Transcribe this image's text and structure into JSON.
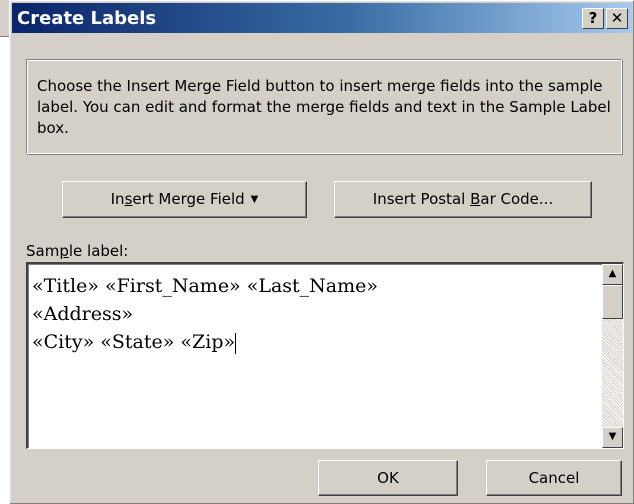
{
  "dialog": {
    "title": "Create Labels",
    "help_glyph": "?",
    "close_glyph": "✕",
    "instructions": "Choose the Insert Merge Field button to insert merge fields into the sample label.  You can edit and format the merge fields and text in the Sample Label box."
  },
  "buttons": {
    "merge_pre": "In",
    "merge_key": "s",
    "merge_post": "ert Merge Field",
    "merge_arrow": "▼",
    "postal_pre": "Insert Postal ",
    "postal_key": "B",
    "postal_post": "ar Code...",
    "ok": "OK",
    "cancel": "Cancel"
  },
  "sample": {
    "label_pre": "Sam",
    "label_key": "p",
    "label_post": "le label:",
    "lines": [
      "«Title» «First_Name» «Last_Name»",
      "«Address»",
      "«City» «State» «Zip»"
    ]
  },
  "scrollbar": {
    "up_glyph": "▲",
    "down_glyph": "▼"
  }
}
